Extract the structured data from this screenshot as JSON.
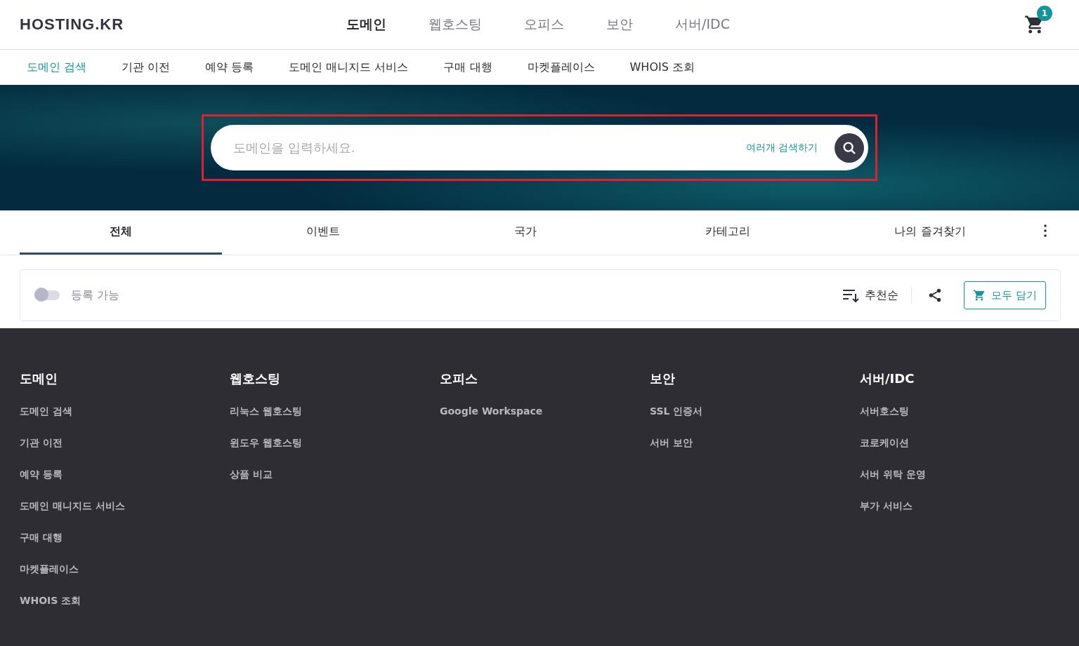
{
  "header": {
    "logo": "HOSTING.KR",
    "nav": [
      {
        "label": "도메인",
        "selected": true
      },
      {
        "label": "웹호스팅",
        "selected": false
      },
      {
        "label": "오피스",
        "selected": false
      },
      {
        "label": "보안",
        "selected": false
      },
      {
        "label": "서버/IDC",
        "selected": false
      }
    ],
    "cart_count": "1"
  },
  "subnav": [
    {
      "label": "도메인 검색",
      "selected": true
    },
    {
      "label": "기관 이전",
      "selected": false
    },
    {
      "label": "예약 등록",
      "selected": false
    },
    {
      "label": "도메인 매니지드 서비스",
      "selected": false
    },
    {
      "label": "구매 대행",
      "selected": false
    },
    {
      "label": "마켓플레이스",
      "selected": false
    },
    {
      "label": "WHOIS 조회",
      "selected": false
    }
  ],
  "search": {
    "placeholder": "도메인을 입력하세요.",
    "multi_search": "여러개 검색하기",
    "highlighted": true
  },
  "tabs": [
    {
      "label": "전체",
      "selected": true
    },
    {
      "label": "이벤트",
      "selected": false
    },
    {
      "label": "국가",
      "selected": false
    },
    {
      "label": "카테고리",
      "selected": false
    },
    {
      "label": "나의 즐겨찾기",
      "selected": false
    }
  ],
  "filter_bar": {
    "available_toggle": {
      "label": "등록 가능",
      "on": false
    },
    "sort": "추천순",
    "add_all": "모두 담기"
  },
  "footer": {
    "columns": [
      {
        "title": "도메인",
        "links": [
          "도메인 검색",
          "기관 이전",
          "예약 등록",
          "도메인 매니지드 서비스",
          "구매 대행",
          "마켓플레이스",
          "WHOIS 조회"
        ]
      },
      {
        "title": "웹호스팅",
        "links": [
          "리눅스 웹호스팅",
          "윈도우 웹호스팅",
          "상품 비교"
        ]
      },
      {
        "title": "오피스",
        "links": [
          "Google Workspace"
        ]
      },
      {
        "title": "보안",
        "links": [
          "SSL 인증서",
          "서버 보안"
        ]
      },
      {
        "title": "서버/IDC",
        "links": [
          "서버호스팅",
          "코로케이션",
          "서버 위탁 운영",
          "부가 서비스"
        ]
      }
    ]
  }
}
